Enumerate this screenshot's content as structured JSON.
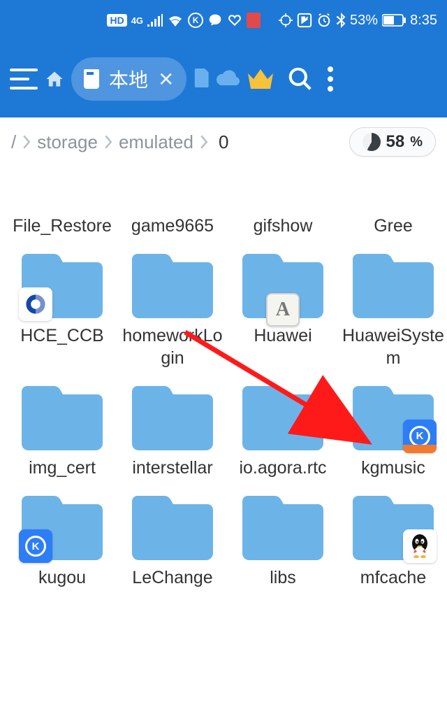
{
  "statusbar": {
    "hd": "HD",
    "4g": "4G",
    "battery_text": "53%",
    "time": "8:35"
  },
  "appbar": {
    "tab_label": "本地"
  },
  "breadcrumb": {
    "root": "/",
    "seg1": "storage",
    "seg2": "emulated",
    "seg3": "0"
  },
  "storage": {
    "percent": "58",
    "sign": "%"
  },
  "folders": [
    {
      "name": "File_Restore"
    },
    {
      "name": "game9665"
    },
    {
      "name": "gifshow"
    },
    {
      "name": "Gree"
    },
    {
      "name": "HCE_CCB"
    },
    {
      "name": "homeworkLogin"
    },
    {
      "name": "Huawei"
    },
    {
      "name": "HuaweiSystem"
    },
    {
      "name": "img_cert"
    },
    {
      "name": "interstellar"
    },
    {
      "name": "io.agora.rtc"
    },
    {
      "name": "kgmusic"
    },
    {
      "name": "kugou"
    },
    {
      "name": "LeChange"
    },
    {
      "name": "libs"
    },
    {
      "name": "mfcache"
    }
  ],
  "overlays": {
    "a_letter": "A",
    "k_letter": "K"
  }
}
